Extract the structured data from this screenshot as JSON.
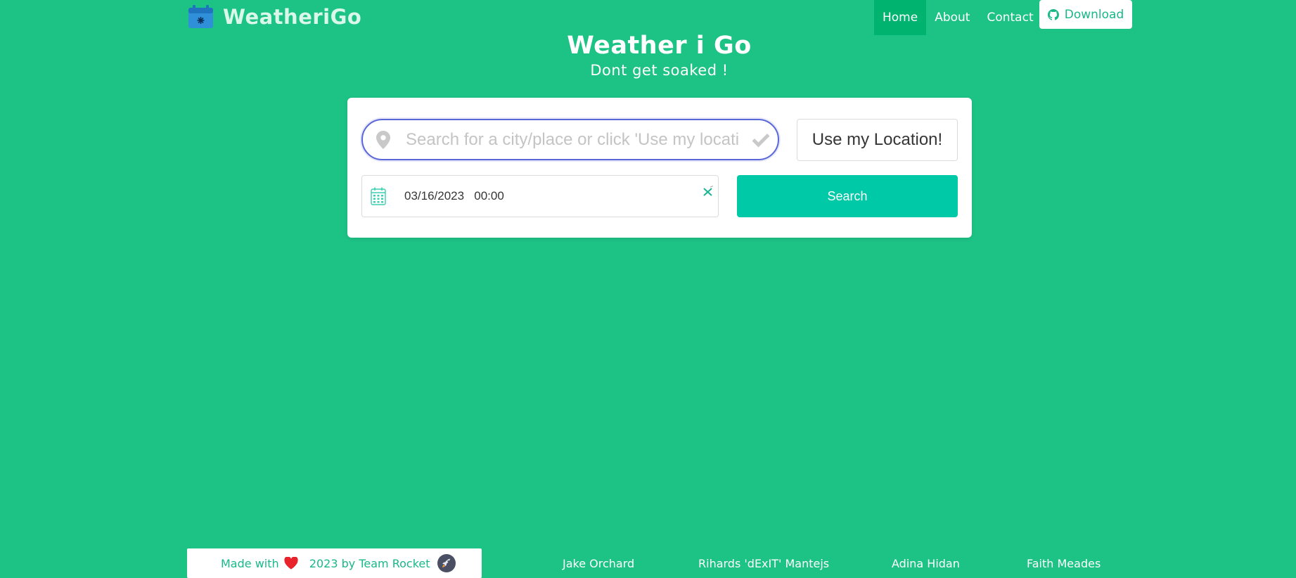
{
  "brand": {
    "name": "WeatheriGo",
    "icon": "calendar-icon"
  },
  "nav": {
    "links": [
      {
        "label": "Home",
        "active": true
      },
      {
        "label": "About",
        "active": false
      },
      {
        "label": "Contact",
        "active": false
      }
    ],
    "download_label": "Download",
    "download_icon": "github-icon"
  },
  "hero": {
    "title": "Weather i Go",
    "subtitle": "Dont get soaked !"
  },
  "search": {
    "placeholder": "Search for a city/place or click 'Use my location!'",
    "value": "",
    "location_button": "Use my Location!",
    "date_value": "03/16/2023   00:00",
    "search_button": "Search"
  },
  "footer": {
    "made_prefix": "Made with",
    "made_suffix": "  2023 by Team Rocket",
    "members": [
      "Jake Orchard",
      "Rihards 'dExIT' Mantejs",
      "Adina Hidan",
      "Faith Meades"
    ]
  },
  "colors": {
    "background": "#1dc285",
    "active_nav": "#00b36e",
    "search_button": "#00c9a7",
    "input_focus": "#5a67d8"
  }
}
